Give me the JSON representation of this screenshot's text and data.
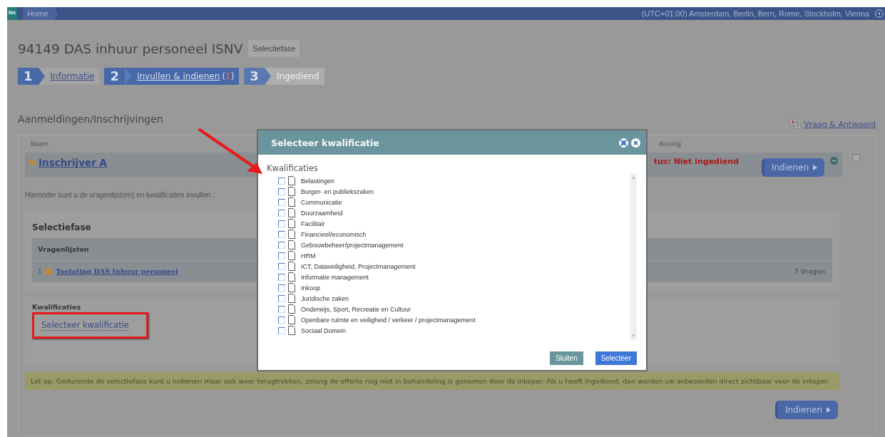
{
  "topbar": {
    "logo": "Nx",
    "breadcrumb": "Home",
    "timezone": "(UTC+01:00) Amsterdam, Berlin, Bern, Rome, Stockholm, Vienna"
  },
  "title": "94149 DAS inhuur personeel ISNV",
  "phase_badge": "Selectiefase",
  "steps": [
    {
      "number": "1",
      "label": "Informatie",
      "selected": false,
      "disabled": false
    },
    {
      "number": "2",
      "label": "Invullen & indienen",
      "count": "(1)",
      "selected": true,
      "disabled": false
    },
    {
      "number": "3",
      "label": "Ingediend",
      "selected": false,
      "disabled": true
    }
  ],
  "section_title": "Aanmeldingen/Inschrijvingen",
  "qa_link": "Vraag & Antwoord",
  "table": {
    "columns": [
      "Naam",
      "diening"
    ],
    "row": {
      "name": "Inschrijver A",
      "status": "tus: Niet ingediend",
      "submit": "Indienen",
      "selected": false
    }
  },
  "intro": "Hieronder kunt u de vragenlijst(en) en kwalificaties invullen :",
  "phase": {
    "title": "Selectiefase",
    "list_header": "Vragenlijsten",
    "items": [
      {
        "number": "1",
        "name": "Toelating DAS Inhuur personeel",
        "count": "7 Vragen"
      }
    ]
  },
  "qualifications": {
    "title": "Kwalificaties",
    "link": "Selecteer kwalificatie"
  },
  "note": "Let op: Gedurende de selectiefase kunt u indienen maar ook weer terugtrekken, zolang de offerte nog niet in behandeling is genomen door de inkoper. Als u heeft ingediend, dan worden uw antwoorden direct zichtbaar voor de inkoper.",
  "bottom_submit": "Indienen",
  "dialog": {
    "title": "Selecteer kwalificatie",
    "label": "Kwalificaties",
    "items": [
      {
        "label": "Belastingen",
        "checked": false
      },
      {
        "label": "Burger- en publiekszaken",
        "checked": false
      },
      {
        "label": "Communicatie",
        "checked": false
      },
      {
        "label": "Duurzaamheid",
        "checked": false
      },
      {
        "label": "Facilitair",
        "checked": false
      },
      {
        "label": "Financieel/economisch",
        "checked": false
      },
      {
        "label": "Gebouwbeheer/projectmanagement",
        "checked": false
      },
      {
        "label": "HRM",
        "checked": false
      },
      {
        "label": "ICT, Dataveiligheid, Projectmanagement",
        "checked": false
      },
      {
        "label": "Informatie management",
        "checked": false
      },
      {
        "label": "Inkoop",
        "checked": false
      },
      {
        "label": "Juridische zaken",
        "checked": false
      },
      {
        "label": "Onderwijs, Sport, Recreatie en Cultuur",
        "checked": false
      },
      {
        "label": "Openbare ruimte en veiligheid / verkeer / projectmanagement",
        "checked": false
      },
      {
        "label": "Sociaal Domein",
        "checked": false
      }
    ],
    "buttons": [
      {
        "label": "Sluiten",
        "kind": "secondary"
      },
      {
        "label": "Selecteer",
        "kind": "primary"
      }
    ]
  }
}
